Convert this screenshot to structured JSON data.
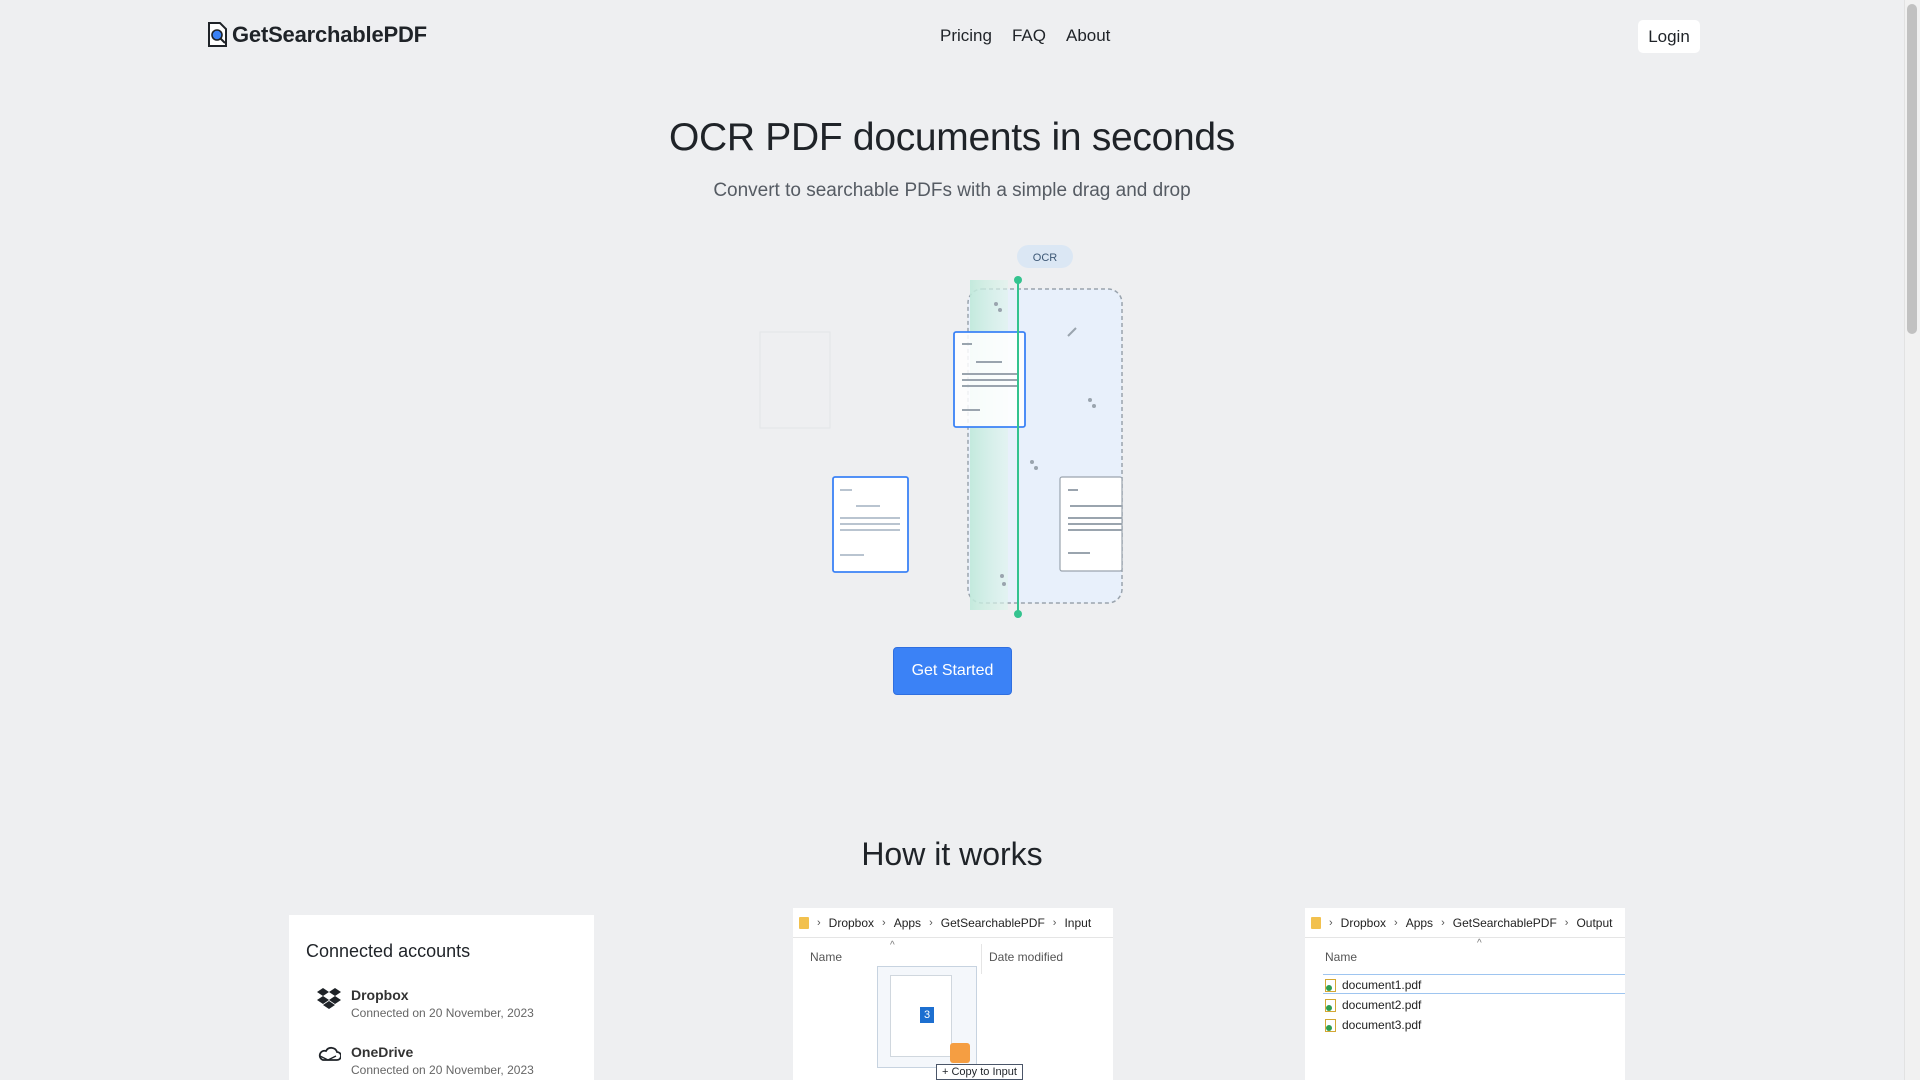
{
  "header": {
    "logo_text": "GetSearchablePDF",
    "nav": [
      "Pricing",
      "FAQ",
      "About"
    ],
    "login_label": "Login"
  },
  "hero": {
    "title": "OCR PDF documents in seconds",
    "subtitle": "Convert to searchable PDFs with a simple drag and drop",
    "ocr_badge": "OCR",
    "cta_label": "Get Started"
  },
  "how": {
    "title": "How it works",
    "accounts": {
      "title": "Connected accounts",
      "items": [
        {
          "name": "Dropbox",
          "date": "Connected on 20 November, 2023",
          "icon": "dropbox-icon"
        },
        {
          "name": "OneDrive",
          "date": "Connected on 20 November, 2023",
          "icon": "onedrive-icon"
        }
      ]
    },
    "input_window": {
      "breadcrumb": [
        "Dropbox",
        "Apps",
        "GetSearchablePDF",
        "Input"
      ],
      "col_name": "Name",
      "col_date": "Date modified",
      "drag_count": "3",
      "drag_tooltip": "+ Copy to Input"
    },
    "output_window": {
      "breadcrumb": [
        "Dropbox",
        "Apps",
        "GetSearchablePDF",
        "Output"
      ],
      "col_name": "Name",
      "files": [
        "document1.pdf",
        "document2.pdf",
        "document3.pdf"
      ]
    }
  },
  "colors": {
    "accent": "#3b82f6",
    "ocr_line": "#34c38f",
    "background": "#eeeff1"
  }
}
